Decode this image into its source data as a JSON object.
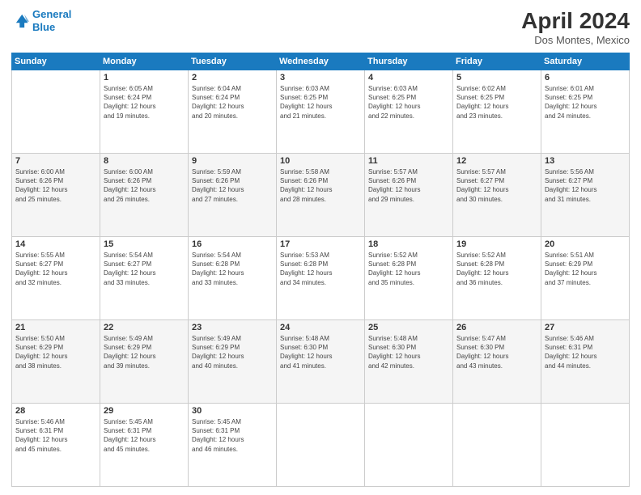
{
  "header": {
    "logo_line1": "General",
    "logo_line2": "Blue",
    "month_title": "April 2024",
    "location": "Dos Montes, Mexico"
  },
  "days_of_week": [
    "Sunday",
    "Monday",
    "Tuesday",
    "Wednesday",
    "Thursday",
    "Friday",
    "Saturday"
  ],
  "weeks": [
    [
      {
        "day": "",
        "info": ""
      },
      {
        "day": "1",
        "info": "Sunrise: 6:05 AM\nSunset: 6:24 PM\nDaylight: 12 hours\nand 19 minutes."
      },
      {
        "day": "2",
        "info": "Sunrise: 6:04 AM\nSunset: 6:24 PM\nDaylight: 12 hours\nand 20 minutes."
      },
      {
        "day": "3",
        "info": "Sunrise: 6:03 AM\nSunset: 6:25 PM\nDaylight: 12 hours\nand 21 minutes."
      },
      {
        "day": "4",
        "info": "Sunrise: 6:03 AM\nSunset: 6:25 PM\nDaylight: 12 hours\nand 22 minutes."
      },
      {
        "day": "5",
        "info": "Sunrise: 6:02 AM\nSunset: 6:25 PM\nDaylight: 12 hours\nand 23 minutes."
      },
      {
        "day": "6",
        "info": "Sunrise: 6:01 AM\nSunset: 6:25 PM\nDaylight: 12 hours\nand 24 minutes."
      }
    ],
    [
      {
        "day": "7",
        "info": "Sunrise: 6:00 AM\nSunset: 6:26 PM\nDaylight: 12 hours\nand 25 minutes."
      },
      {
        "day": "8",
        "info": "Sunrise: 6:00 AM\nSunset: 6:26 PM\nDaylight: 12 hours\nand 26 minutes."
      },
      {
        "day": "9",
        "info": "Sunrise: 5:59 AM\nSunset: 6:26 PM\nDaylight: 12 hours\nand 27 minutes."
      },
      {
        "day": "10",
        "info": "Sunrise: 5:58 AM\nSunset: 6:26 PM\nDaylight: 12 hours\nand 28 minutes."
      },
      {
        "day": "11",
        "info": "Sunrise: 5:57 AM\nSunset: 6:26 PM\nDaylight: 12 hours\nand 29 minutes."
      },
      {
        "day": "12",
        "info": "Sunrise: 5:57 AM\nSunset: 6:27 PM\nDaylight: 12 hours\nand 30 minutes."
      },
      {
        "day": "13",
        "info": "Sunrise: 5:56 AM\nSunset: 6:27 PM\nDaylight: 12 hours\nand 31 minutes."
      }
    ],
    [
      {
        "day": "14",
        "info": "Sunrise: 5:55 AM\nSunset: 6:27 PM\nDaylight: 12 hours\nand 32 minutes."
      },
      {
        "day": "15",
        "info": "Sunrise: 5:54 AM\nSunset: 6:27 PM\nDaylight: 12 hours\nand 33 minutes."
      },
      {
        "day": "16",
        "info": "Sunrise: 5:54 AM\nSunset: 6:28 PM\nDaylight: 12 hours\nand 33 minutes."
      },
      {
        "day": "17",
        "info": "Sunrise: 5:53 AM\nSunset: 6:28 PM\nDaylight: 12 hours\nand 34 minutes."
      },
      {
        "day": "18",
        "info": "Sunrise: 5:52 AM\nSunset: 6:28 PM\nDaylight: 12 hours\nand 35 minutes."
      },
      {
        "day": "19",
        "info": "Sunrise: 5:52 AM\nSunset: 6:28 PM\nDaylight: 12 hours\nand 36 minutes."
      },
      {
        "day": "20",
        "info": "Sunrise: 5:51 AM\nSunset: 6:29 PM\nDaylight: 12 hours\nand 37 minutes."
      }
    ],
    [
      {
        "day": "21",
        "info": "Sunrise: 5:50 AM\nSunset: 6:29 PM\nDaylight: 12 hours\nand 38 minutes."
      },
      {
        "day": "22",
        "info": "Sunrise: 5:49 AM\nSunset: 6:29 PM\nDaylight: 12 hours\nand 39 minutes."
      },
      {
        "day": "23",
        "info": "Sunrise: 5:49 AM\nSunset: 6:29 PM\nDaylight: 12 hours\nand 40 minutes."
      },
      {
        "day": "24",
        "info": "Sunrise: 5:48 AM\nSunset: 6:30 PM\nDaylight: 12 hours\nand 41 minutes."
      },
      {
        "day": "25",
        "info": "Sunrise: 5:48 AM\nSunset: 6:30 PM\nDaylight: 12 hours\nand 42 minutes."
      },
      {
        "day": "26",
        "info": "Sunrise: 5:47 AM\nSunset: 6:30 PM\nDaylight: 12 hours\nand 43 minutes."
      },
      {
        "day": "27",
        "info": "Sunrise: 5:46 AM\nSunset: 6:31 PM\nDaylight: 12 hours\nand 44 minutes."
      }
    ],
    [
      {
        "day": "28",
        "info": "Sunrise: 5:46 AM\nSunset: 6:31 PM\nDaylight: 12 hours\nand 45 minutes."
      },
      {
        "day": "29",
        "info": "Sunrise: 5:45 AM\nSunset: 6:31 PM\nDaylight: 12 hours\nand 45 minutes."
      },
      {
        "day": "30",
        "info": "Sunrise: 5:45 AM\nSunset: 6:31 PM\nDaylight: 12 hours\nand 46 minutes."
      },
      {
        "day": "",
        "info": ""
      },
      {
        "day": "",
        "info": ""
      },
      {
        "day": "",
        "info": ""
      },
      {
        "day": "",
        "info": ""
      }
    ]
  ]
}
